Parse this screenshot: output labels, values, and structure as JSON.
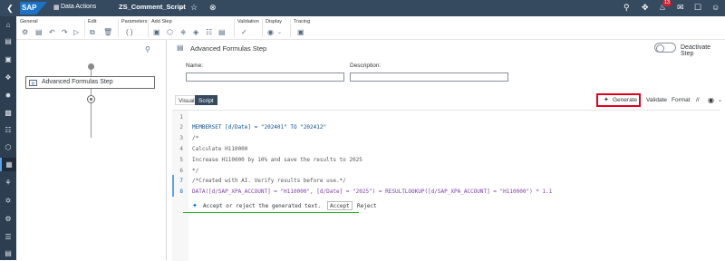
{
  "shell": {
    "app_name": "Data Actions",
    "doc_name": "ZS_Comment_Script",
    "notification_count": "13",
    "logo_text": "SAP"
  },
  "toolbar": {
    "groups": {
      "general": "General",
      "edit": "Edit",
      "parameters": "Parameters",
      "add_step": "Add Step",
      "validation": "Validation",
      "display": "Display",
      "tracing": "Tracing"
    }
  },
  "flow": {
    "step_label": "Advanced Formulas Step"
  },
  "step": {
    "title": "Advanced Formulas Step",
    "deactivate_label": "Deactivate Step",
    "name_label": "Name:",
    "name_value": "",
    "description_label": "Description:",
    "description_value": ""
  },
  "editor_tabs": {
    "visual": "Visual",
    "script": "Script"
  },
  "editor_toolbar": {
    "generate": "Generate",
    "validate": "Validate",
    "format": "Format",
    "comment": "//"
  },
  "code": {
    "line_numbers": [
      "1",
      "2",
      "3",
      "4",
      "5",
      "6",
      "7",
      "8"
    ],
    "lines": [
      "",
      "MEMBERSET [d/Date] = \"202401\" TO \"202412\"",
      "/*",
      "Calculate H110000",
      "Increase H110000 by 10% and save the results to 2025",
      "*/",
      "/*Created with AI. Verify results before use.*/",
      "DATA([d/SAP_XPA_ACCOUNT] = \"H110000\", [d/Date] = \"2025\") = RESULTLOOKUP([d/SAP_XPA_ACCOUNT] = \"H110000\") * 1.1"
    ]
  },
  "ai_suggestion": {
    "text": "Accept or reject the generated text.",
    "accept": "Accept",
    "reject": "Reject"
  },
  "colors": {
    "shell": "#354a5f",
    "nav": "#2d3e50",
    "highlight": "#e3001b",
    "underline": "#2db62d"
  }
}
